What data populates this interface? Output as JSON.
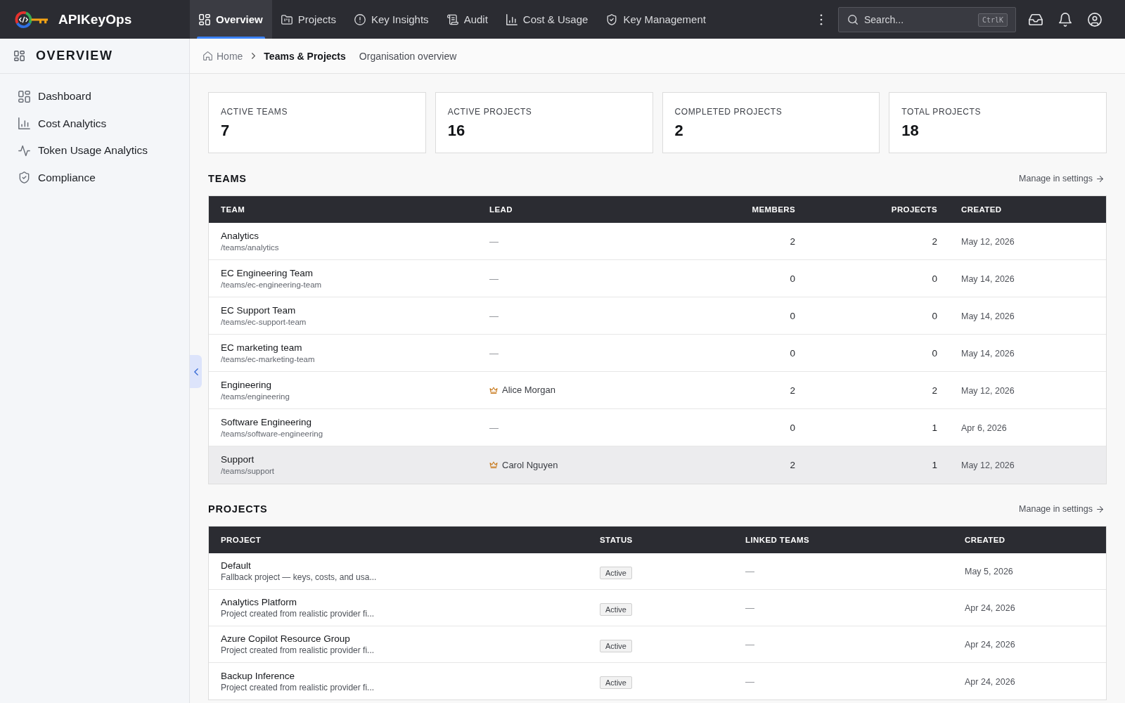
{
  "brand": {
    "name": "APIKeyOps"
  },
  "top_nav": {
    "tabs": [
      {
        "label": "Overview",
        "selected": true
      },
      {
        "label": "Projects",
        "selected": false
      },
      {
        "label": "Key Insights",
        "selected": false
      },
      {
        "label": "Audit",
        "selected": false
      },
      {
        "label": "Cost & Usage",
        "selected": false
      },
      {
        "label": "Key Management",
        "selected": false
      }
    ],
    "search": {
      "placeholder": "Search...",
      "shortcut": "CtrlK"
    }
  },
  "sidebar": {
    "title": "OVERVIEW",
    "items": [
      {
        "label": "Dashboard"
      },
      {
        "label": "Cost Analytics"
      },
      {
        "label": "Token Usage Analytics"
      },
      {
        "label": "Compliance"
      }
    ]
  },
  "breadcrumb": {
    "home": "Home",
    "current": "Teams & Projects",
    "subtitle": "Organisation overview"
  },
  "stats": [
    {
      "label": "ACTIVE TEAMS",
      "value": "7"
    },
    {
      "label": "ACTIVE PROJECTS",
      "value": "16"
    },
    {
      "label": "COMPLETED PROJECTS",
      "value": "2"
    },
    {
      "label": "TOTAL PROJECTS",
      "value": "18"
    }
  ],
  "teams": {
    "title": "TEAMS",
    "link": "Manage in settings",
    "columns": [
      "TEAM",
      "LEAD",
      "MEMBERS",
      "PROJECTS",
      "CREATED"
    ],
    "rows": [
      {
        "name": "Analytics",
        "path": "/teams/analytics",
        "lead": {
          "kind": "none",
          "text": "—"
        },
        "members": "2",
        "projects": "2",
        "created": "May 12, 2026",
        "hovered": false
      },
      {
        "name": "EC Engineering Team",
        "path": "/teams/ec-engineering-team",
        "lead": {
          "kind": "none",
          "text": "—"
        },
        "members": "0",
        "projects": "0",
        "created": "May 14, 2026",
        "hovered": false
      },
      {
        "name": "EC Support Team",
        "path": "/teams/ec-support-team",
        "lead": {
          "kind": "none",
          "text": "—"
        },
        "members": "0",
        "projects": "0",
        "created": "May 14, 2026",
        "hovered": false
      },
      {
        "name": "EC marketing team",
        "path": "/teams/ec-marketing-team",
        "lead": {
          "kind": "none",
          "text": "—"
        },
        "members": "0",
        "projects": "0",
        "created": "May 14, 2026",
        "hovered": false
      },
      {
        "name": "Engineering",
        "path": "/teams/engineering",
        "lead": {
          "kind": "person",
          "text": "Alice Morgan"
        },
        "members": "2",
        "projects": "2",
        "created": "May 12, 2026",
        "hovered": false
      },
      {
        "name": "Software Engineering",
        "path": "/teams/software-engineering",
        "lead": {
          "kind": "none",
          "text": "—"
        },
        "members": "0",
        "projects": "1",
        "created": "Apr 6, 2026",
        "hovered": false
      },
      {
        "name": "Support",
        "path": "/teams/support",
        "lead": {
          "kind": "person",
          "text": "Carol Nguyen"
        },
        "members": "2",
        "projects": "1",
        "created": "May 12, 2026",
        "hovered": true
      }
    ]
  },
  "projects": {
    "title": "PROJECTS",
    "link": "Manage in settings",
    "columns": [
      "PROJECT",
      "STATUS",
      "LINKED TEAMS",
      "CREATED"
    ],
    "rows": [
      {
        "name": "Default",
        "description": "Fallback project — keys, costs, and usa...",
        "status": "Active",
        "linked_teams": "—",
        "created": "May 5, 2026"
      },
      {
        "name": "Analytics Platform",
        "description": "Project created from realistic provider fi...",
        "status": "Active",
        "linked_teams": "—",
        "created": "Apr 24, 2026"
      },
      {
        "name": "Azure Copilot Resource Group",
        "description": "Project created from realistic provider fi...",
        "status": "Active",
        "linked_teams": "—",
        "created": "Apr 24, 2026"
      },
      {
        "name": "Backup Inference",
        "description": "Project created from realistic provider fi...",
        "status": "Active",
        "linked_teams": "—",
        "created": "Apr 24, 2026"
      }
    ]
  }
}
